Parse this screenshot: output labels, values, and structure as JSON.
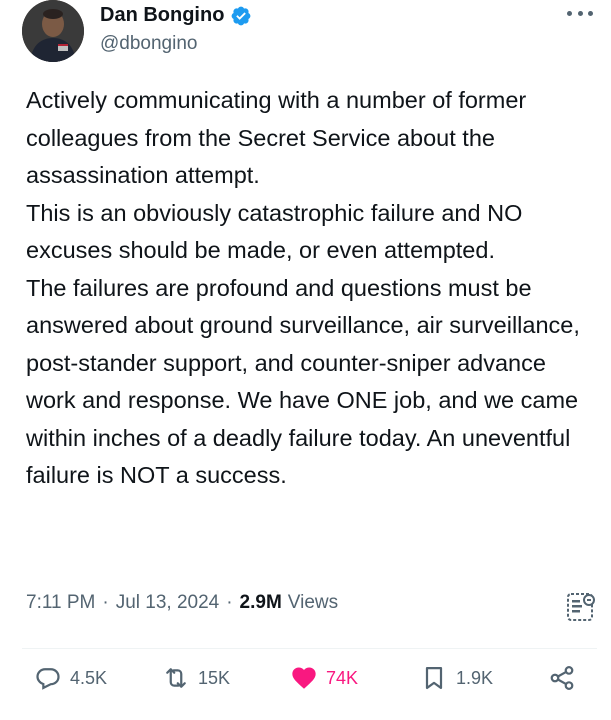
{
  "author": {
    "display_name": "Dan Bongino",
    "handle": "@dbongino"
  },
  "tweet": {
    "paragraphs": [
      "Actively communicating with a number of former colleagues from the Secret Service about the assassination attempt.",
      "This is an obviously catastrophic failure and NO excuses should be made, or even attempted.",
      "The failures are profound and questions must be answered about ground surveillance, air surveillance, post-stander support, and counter-sniper advance work and response. We have ONE job, and we came within inches of a deadly failure today. An uneventful failure is NOT a success."
    ]
  },
  "meta": {
    "time": "7:11 PM",
    "separator": "·",
    "date": "Jul 13, 2024",
    "views_count": "2.9M",
    "views_label": "Views"
  },
  "actions": {
    "replies": "4.5K",
    "reposts": "15K",
    "likes": "74K",
    "bookmarks": "1.9K"
  },
  "colors": {
    "text": "#0f1419",
    "secondary": "#536471",
    "verified": "#1d9bf0",
    "like": "#f91880",
    "divider": "#eff3f4"
  },
  "icons": {
    "verified": "verified-badge-icon",
    "more": "more-icon",
    "analytics": "analytics-icon",
    "reply": "reply-icon",
    "repost": "repost-icon",
    "like": "heart-icon",
    "bookmark": "bookmark-icon",
    "share": "share-icon"
  }
}
